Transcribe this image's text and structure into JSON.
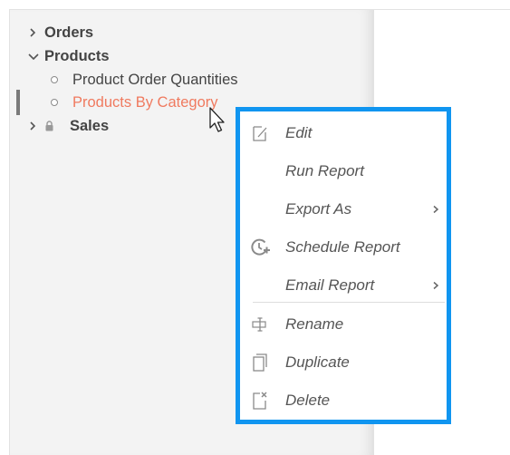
{
  "tree": {
    "items": [
      {
        "label": "Orders",
        "state": "collapsed"
      },
      {
        "label": "Products",
        "state": "expanded",
        "children": [
          {
            "label": "Product Order Quantities"
          },
          {
            "label": "Products By Category",
            "selected": true
          }
        ]
      },
      {
        "label": "Sales",
        "state": "collapsed",
        "locked": true
      }
    ]
  },
  "context_menu": {
    "items": [
      {
        "label": "Edit",
        "icon": "edit-icon"
      },
      {
        "label": "Run Report",
        "icon": ""
      },
      {
        "label": "Export As",
        "icon": "",
        "submenu": true
      },
      {
        "label": "Schedule Report",
        "icon": "schedule-icon"
      },
      {
        "label": "Email Report",
        "icon": "",
        "submenu": true
      },
      {
        "label": "Rename",
        "icon": "rename-icon"
      },
      {
        "label": "Duplicate",
        "icon": "duplicate-icon"
      },
      {
        "label": "Delete",
        "icon": "delete-icon"
      }
    ]
  },
  "colors": {
    "highlight_border": "#1095f0",
    "selected_text": "#f07a5f",
    "panel_bg": "#f3f3f3"
  }
}
